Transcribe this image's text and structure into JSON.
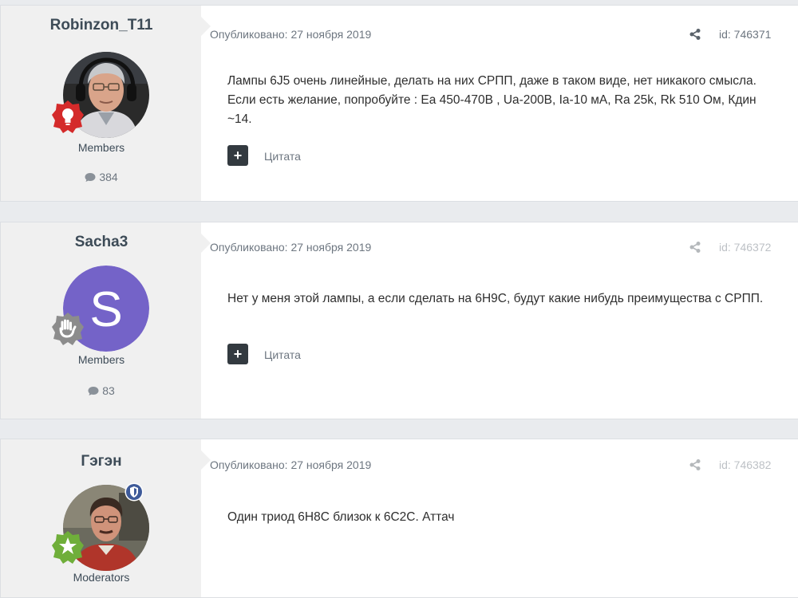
{
  "posts": [
    {
      "username": "Robinzon_T11",
      "group": "Members",
      "post_count": "384",
      "published": "Опубликовано: 27 ноября 2019",
      "post_id": "id: 746371",
      "content": "Лампы 6J5  очень линейные, делать на них СРПП,  даже в таком виде, нет никакого смысла. Если есть желание, попробуйте : Ea 450-470B , Ua-200B, Ia-10 мА,  Ra 25k, Rk 510 Ом, Кдин ~14.",
      "quote_label": "Цитата",
      "badge_color": "#d42a2a",
      "avatar_icon": "user-photo"
    },
    {
      "username": "Sacha3",
      "group": "Members",
      "post_count": "83",
      "published": "Опубликовано: 27 ноября 2019",
      "post_id": "id: 746372",
      "content": "Нет у меня этой лампы, а если сделать на 6Н9С, будут какие нибудь преимущества с СРПП.",
      "quote_label": "Цитата",
      "avatar_letter": "S",
      "avatar_color": "#7463c8",
      "badge_color": "#8c8c8c"
    },
    {
      "username": "Гэгэн",
      "group": "Moderators",
      "published": "Опубликовано: 27 ноября 2019",
      "post_id": "id: 746382",
      "content": "Один триод 6Н8С близок к 6С2С.  Аттач",
      "badge_color": "#6fae3a",
      "mod_badge_color": "#3e5a99",
      "avatar_icon": "user-photo"
    }
  ]
}
